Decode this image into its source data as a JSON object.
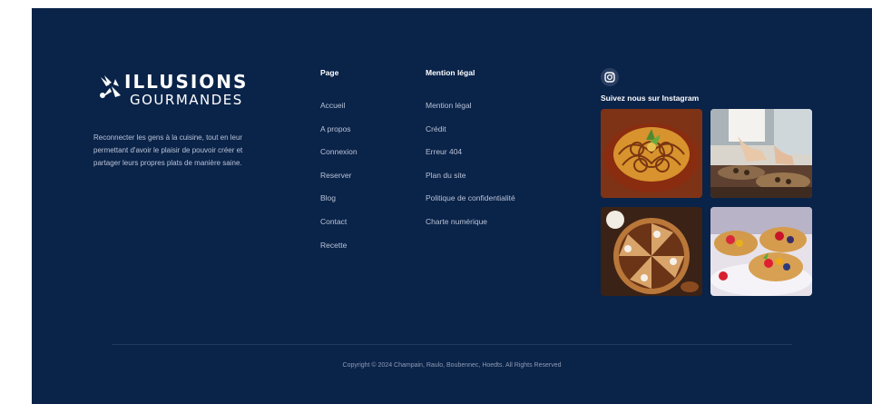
{
  "brand": {
    "name_top": "ILLUSIONS",
    "name_bottom": "GOURMANDES",
    "tagline": "Reconnecter les gens à la cuisine, tout en leur permettant d'avoir le plaisir de pouvoir créer et partager leurs propres plats de manière saine."
  },
  "columns": [
    {
      "title": "Page",
      "links": [
        "Accueil",
        "A propos",
        "Connexion",
        "Reserver",
        "Blog",
        "Contact",
        "Recette"
      ]
    },
    {
      "title": "Mention légal",
      "links": [
        "Mention légal",
        "Crédit",
        "Erreur 404",
        "Plan du site",
        "Politique de confidentialité",
        "Charte numérique"
      ]
    }
  ],
  "instagram": {
    "icon": "instagram-icon",
    "title": "Suivez  nous sur Instagram",
    "photos": [
      "lace-crepe-photo",
      "chef-plating-photo",
      "pecan-pie-photo",
      "fruit-tarts-photo"
    ]
  },
  "copyright": "Copyright © 2024 Champain, Raulo, Boubennec, Hoedts. All Rights Reserved",
  "colors": {
    "background": "#0a2349",
    "text": "#ffffff",
    "muted": "#b9c3d6"
  }
}
